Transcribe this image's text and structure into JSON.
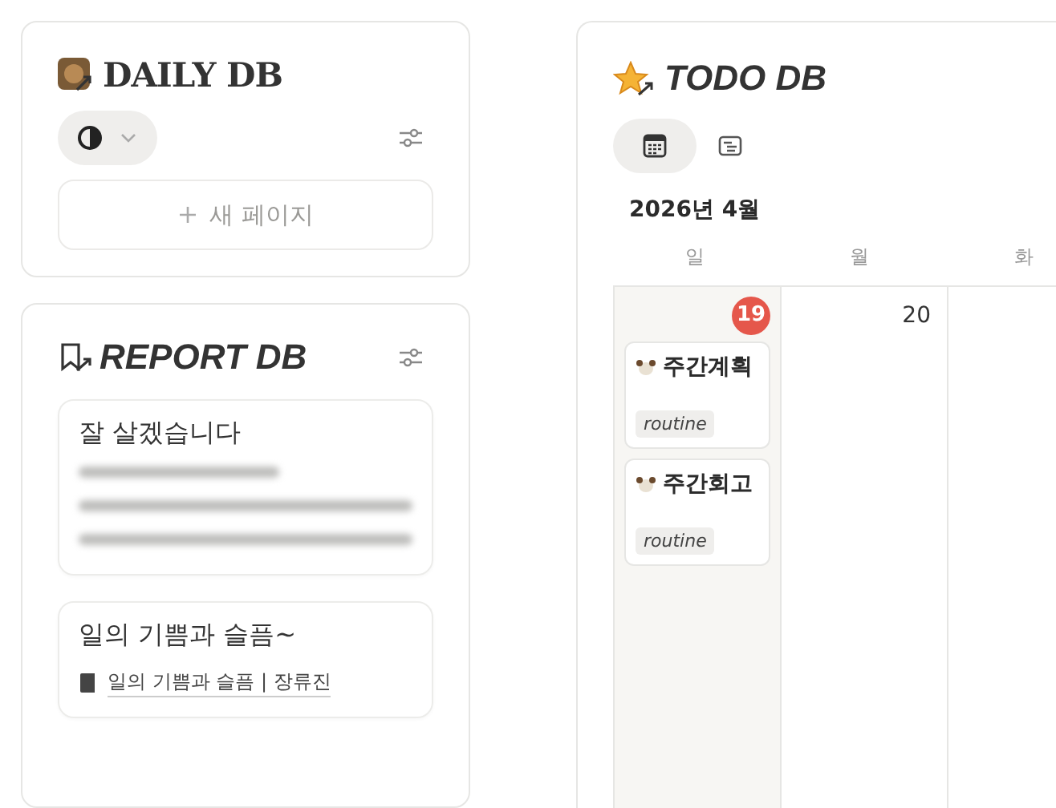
{
  "daily_db": {
    "title": "DAILY DB",
    "new_page_button": "새 페이지"
  },
  "report_db": {
    "title": "REPORT DB",
    "cards": [
      {
        "kind": "blurred",
        "title": "잘 살겠습니다"
      },
      {
        "kind": "link",
        "title": "일의 기쁨과 슬픔~",
        "link": "일의 기쁨과 슬픔 | 장류진"
      }
    ]
  },
  "todo_db": {
    "title": "TODO DB",
    "view_tabs": [
      {
        "kind": "calendar",
        "selected": true
      },
      {
        "kind": "list",
        "selected": false
      }
    ],
    "month": "2026년 4월",
    "weekdays": [
      "일",
      "월",
      "화"
    ],
    "days": [
      {
        "date": "19",
        "today": true,
        "events": [
          {
            "title": "주간계획",
            "tag": "routine"
          },
          {
            "title": "주간회고",
            "tag": "routine"
          }
        ]
      },
      {
        "date": "20",
        "today": false
      }
    ]
  }
}
